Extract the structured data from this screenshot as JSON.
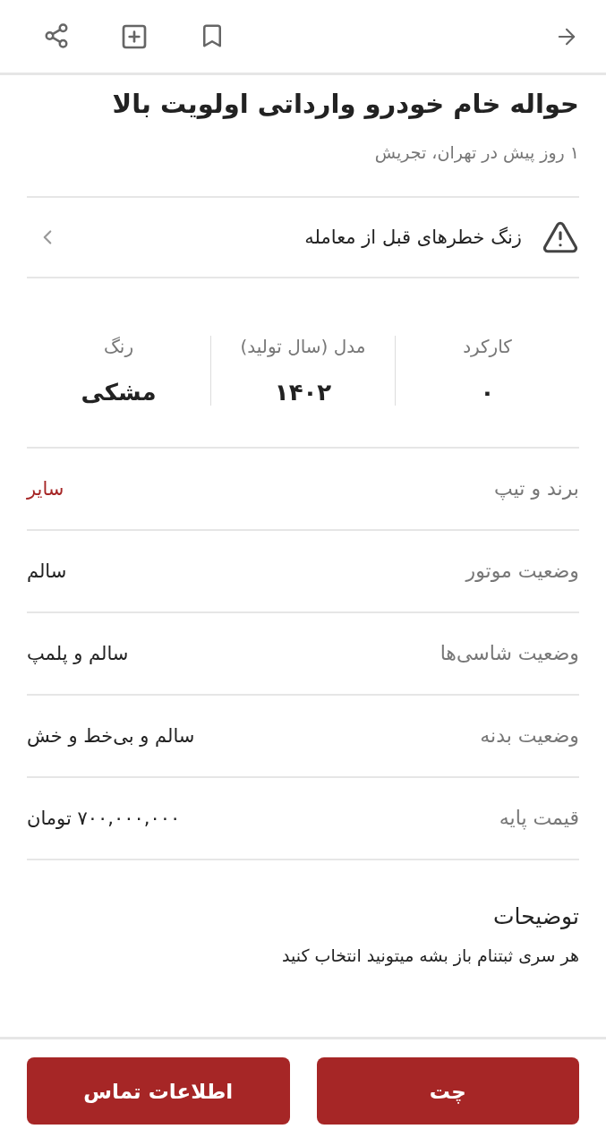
{
  "title": "حواله خام خودرو وارداتی اولویت بالا",
  "subtitle": "۱ روز پیش در تهران، تجریش",
  "warning": {
    "label": "زنگ خطرهای قبل از معامله"
  },
  "stats": [
    {
      "label": "کارکرد",
      "value": "۰"
    },
    {
      "label": "مدل (سال تولید)",
      "value": "۱۴۰۲"
    },
    {
      "label": "رنگ",
      "value": "مشکی"
    }
  ],
  "rows": [
    {
      "label": "برند و تیپ",
      "value": "سایر",
      "kind": "link"
    },
    {
      "label": "وضعیت موتور",
      "value": "سالم",
      "kind": "text"
    },
    {
      "label": "وضعیت شاسی‌ها",
      "value": "سالم و پلمپ",
      "kind": "text"
    },
    {
      "label": "وضعیت بدنه",
      "value": "سالم و بی‌خط و خش",
      "kind": "text"
    },
    {
      "label": "قیمت پایه",
      "value": "۷۰۰,۰۰۰,۰۰۰ تومان",
      "kind": "text"
    }
  ],
  "description": {
    "heading": "توضیحات",
    "text": "هر سری ثبتنام باز بشه میتونید انتخاب کنید"
  },
  "buttons": [
    "چت",
    "اطلاعات تماس"
  ]
}
